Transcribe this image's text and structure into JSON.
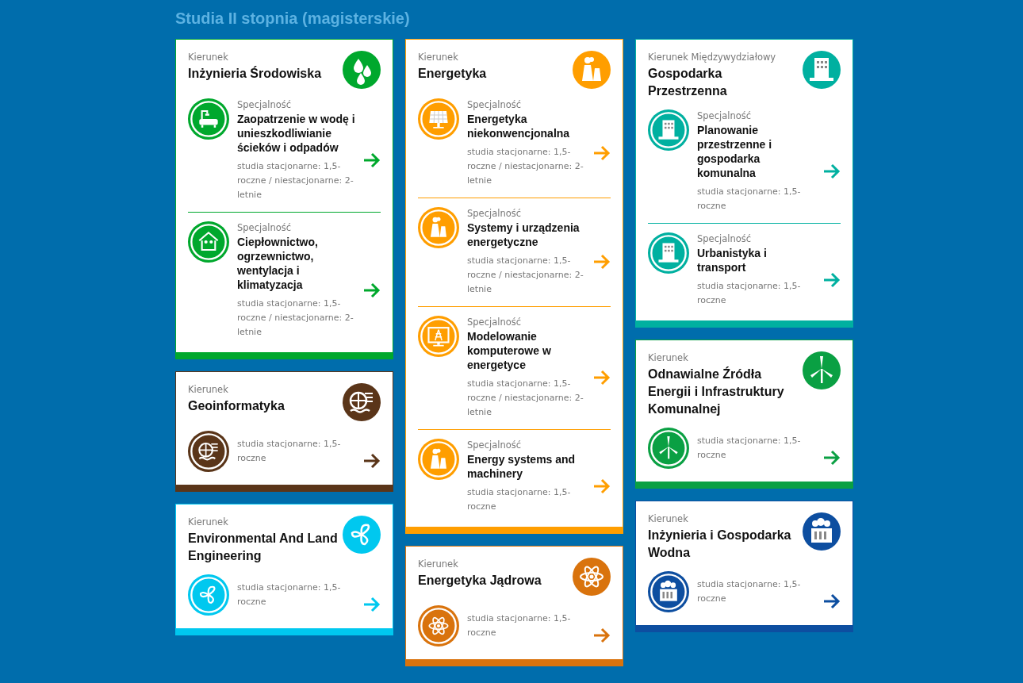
{
  "page_title": "Studia II stopnia (magisterskie)",
  "columns": [
    [
      {
        "label": "Kierunek",
        "title": "Inżynieria Środowiska",
        "color": "#00a82d",
        "specializations": [
          {
            "label": "Specjalność",
            "name": "Zaopatrzenie w wodę i unieszkodliwianie ścieków i odpadów",
            "info": "studia stacjonarne: 1,5-roczne / niestacjonarne: 2-letnie"
          },
          {
            "label": "Specjalność",
            "name": "Ciepłownictwo, ogrzewnictwo, wentylacja i klimatyzacja",
            "info": "studia stacjonarne: 1,5-roczne / niestacjonarne: 2-letnie"
          }
        ]
      },
      {
        "label": "Kierunek",
        "title": "Geoinformatyka",
        "color": "#5a3519",
        "specializations": [
          {
            "info": "studia stacjonarne: 1,5-roczne"
          }
        ]
      },
      {
        "label": "Kierunek",
        "title": "Environmental And Land Engineering",
        "color": "#00c8ef",
        "specializations": [
          {
            "info": "studia stacjonarne: 1,5-roczne"
          }
        ]
      }
    ],
    [
      {
        "label": "Kierunek",
        "title": "Energetyka",
        "color": "#ff9e00",
        "specializations": [
          {
            "label": "Specjalność",
            "name": "Energetyka niekonwencjonalna",
            "info": "studia stacjonarne: 1,5-roczne / niestacjonarne: 2-letnie"
          },
          {
            "label": "Specjalność",
            "name": "Systemy i urządzenia energetyczne",
            "info": "studia stacjonarne: 1,5-roczne / niestacjonarne: 2-letnie"
          },
          {
            "label": "Specjalność",
            "name": "Modelowanie komputerowe w energetyce",
            "info": "studia stacjonarne: 1,5-roczne / niestacjonarne: 2-letnie"
          },
          {
            "label": "Specjalność",
            "name": "Energy systems and machinery",
            "info": "studia stacjonarne: 1,5-roczne"
          }
        ]
      },
      {
        "label": "Kierunek",
        "title": "Energetyka Jądrowa",
        "color": "#d9730d",
        "specializations": [
          {
            "info": "studia stacjonarne: 1,5-roczne"
          }
        ]
      }
    ],
    [
      {
        "label": "Kierunek Międzywydziałowy",
        "title": "Gospodarka Przestrzenna",
        "color": "#00b0a0",
        "specializations": [
          {
            "label": "Specjalność",
            "name": "Planowanie przestrzenne i gospodarka komunalna",
            "info": "studia stacjonarne: 1,5-roczne"
          },
          {
            "label": "Specjalność",
            "name": "Urbanistyka i transport",
            "info": "studia stacjonarne: 1,5-roczne"
          }
        ]
      },
      {
        "label": "Kierunek",
        "title": "Odnawialne Źródła Energii i Infrastruktury Komunalnej",
        "color": "#0aa043",
        "specializations": [
          {
            "info": "studia stacjonarne: 1,5-roczne"
          }
        ]
      },
      {
        "label": "Kierunek",
        "title": "Inżynieria i Gospodarka Wodna",
        "color": "#0d4ea0",
        "specializations": [
          {
            "info": "studia stacjonarne: 1,5-roczne"
          }
        ]
      }
    ]
  ]
}
